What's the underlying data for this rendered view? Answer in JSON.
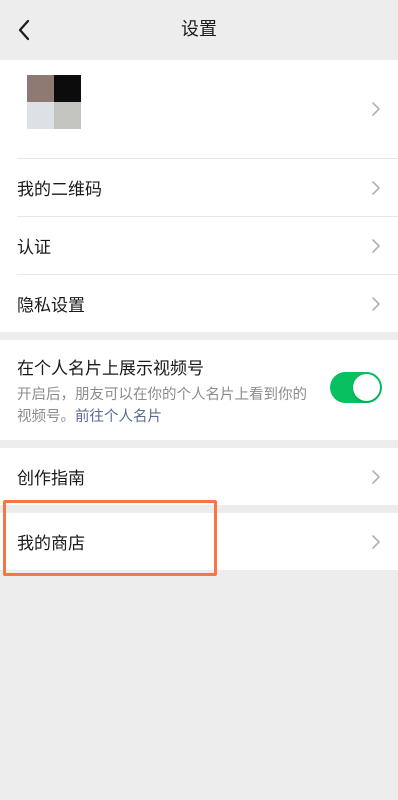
{
  "header": {
    "title": "设置",
    "back_icon": "chevron-left-icon"
  },
  "profile": {
    "avatar_colors": [
      "#8e7a72",
      "#0c0c0c",
      "#dde0e4",
      "#c3c3bf"
    ]
  },
  "items": {
    "qr_code": "我的二维码",
    "verification": "认证",
    "privacy": "隐私设置"
  },
  "show_video": {
    "label": "在个人名片上展示视频号",
    "desc_prefix": "开启后，朋友可以在你的个人名片上看到你的视频号。",
    "desc_link": "前往个人名片",
    "enabled": true
  },
  "guide": "创作指南",
  "shop": "我的商店",
  "colors": {
    "toggle_on": "#07c160",
    "link": "#576b95",
    "highlight": "#fb7443",
    "background": "#ededed"
  }
}
